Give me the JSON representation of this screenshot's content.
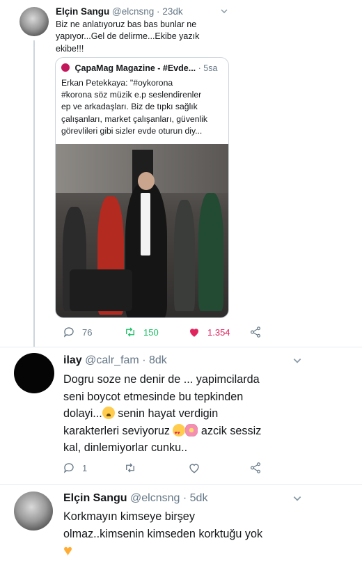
{
  "tweet1": {
    "name": "Elçin Sangu",
    "handle": "@elcnsng",
    "separator": "·",
    "time": "23dk",
    "text_lines": [
      "Biz ne anlatıyoruz bas bas bunlar ne",
      "yapıyor...Gel de delirme...Ekibe yazık",
      "ekibe!!!"
    ],
    "quote": {
      "source_name": "ÇapaMag Magazine - #Evde...",
      "separator": "·",
      "time": "5sa",
      "text_lines": [
        "Erkan Petekkaya: \"#oykorona",
        "#korona söz müzik e.p seslendirenler",
        "ep ve arkadaşları. Biz de tıpkı sağlık",
        "çalışanları, market çalışanları, güvenlik",
        "görevlileri gibi sizler evde oturun diy..."
      ]
    },
    "replies": "76",
    "retweets": "150",
    "likes": "1.354"
  },
  "tweet2": {
    "name": "ilay",
    "handle": "@calr_fam",
    "separator": "·",
    "time": "8dk",
    "line1": "Dogru soze ne denir de ... yapimcilarda",
    "line2": "seni boycot etmesinde bu tepkinden",
    "line3a": "dolayi...",
    "line3b": " senin hayat verdigin",
    "line4a": "karakterleri seviyoruz ",
    "line4b": " azcik sessiz",
    "line5": "kal, dinlemiyorlar cunku..",
    "replies": "1"
  },
  "tweet3": {
    "name": "Elçin Sangu",
    "handle": "@elcnsng",
    "separator": "·",
    "time": "5dk",
    "line1": "Korkmayın kimseye birşey",
    "line2": "olmaz..kimsenin kimseden korktuğu yok"
  },
  "icons": {
    "reply": "reply-icon",
    "retweet": "retweet-icon",
    "like": "heart-icon",
    "share": "share-icon",
    "more": "chevron-down-icon"
  },
  "colors": {
    "retweet": "#17bf63",
    "like": "#e0245e",
    "muted": "#657786"
  }
}
